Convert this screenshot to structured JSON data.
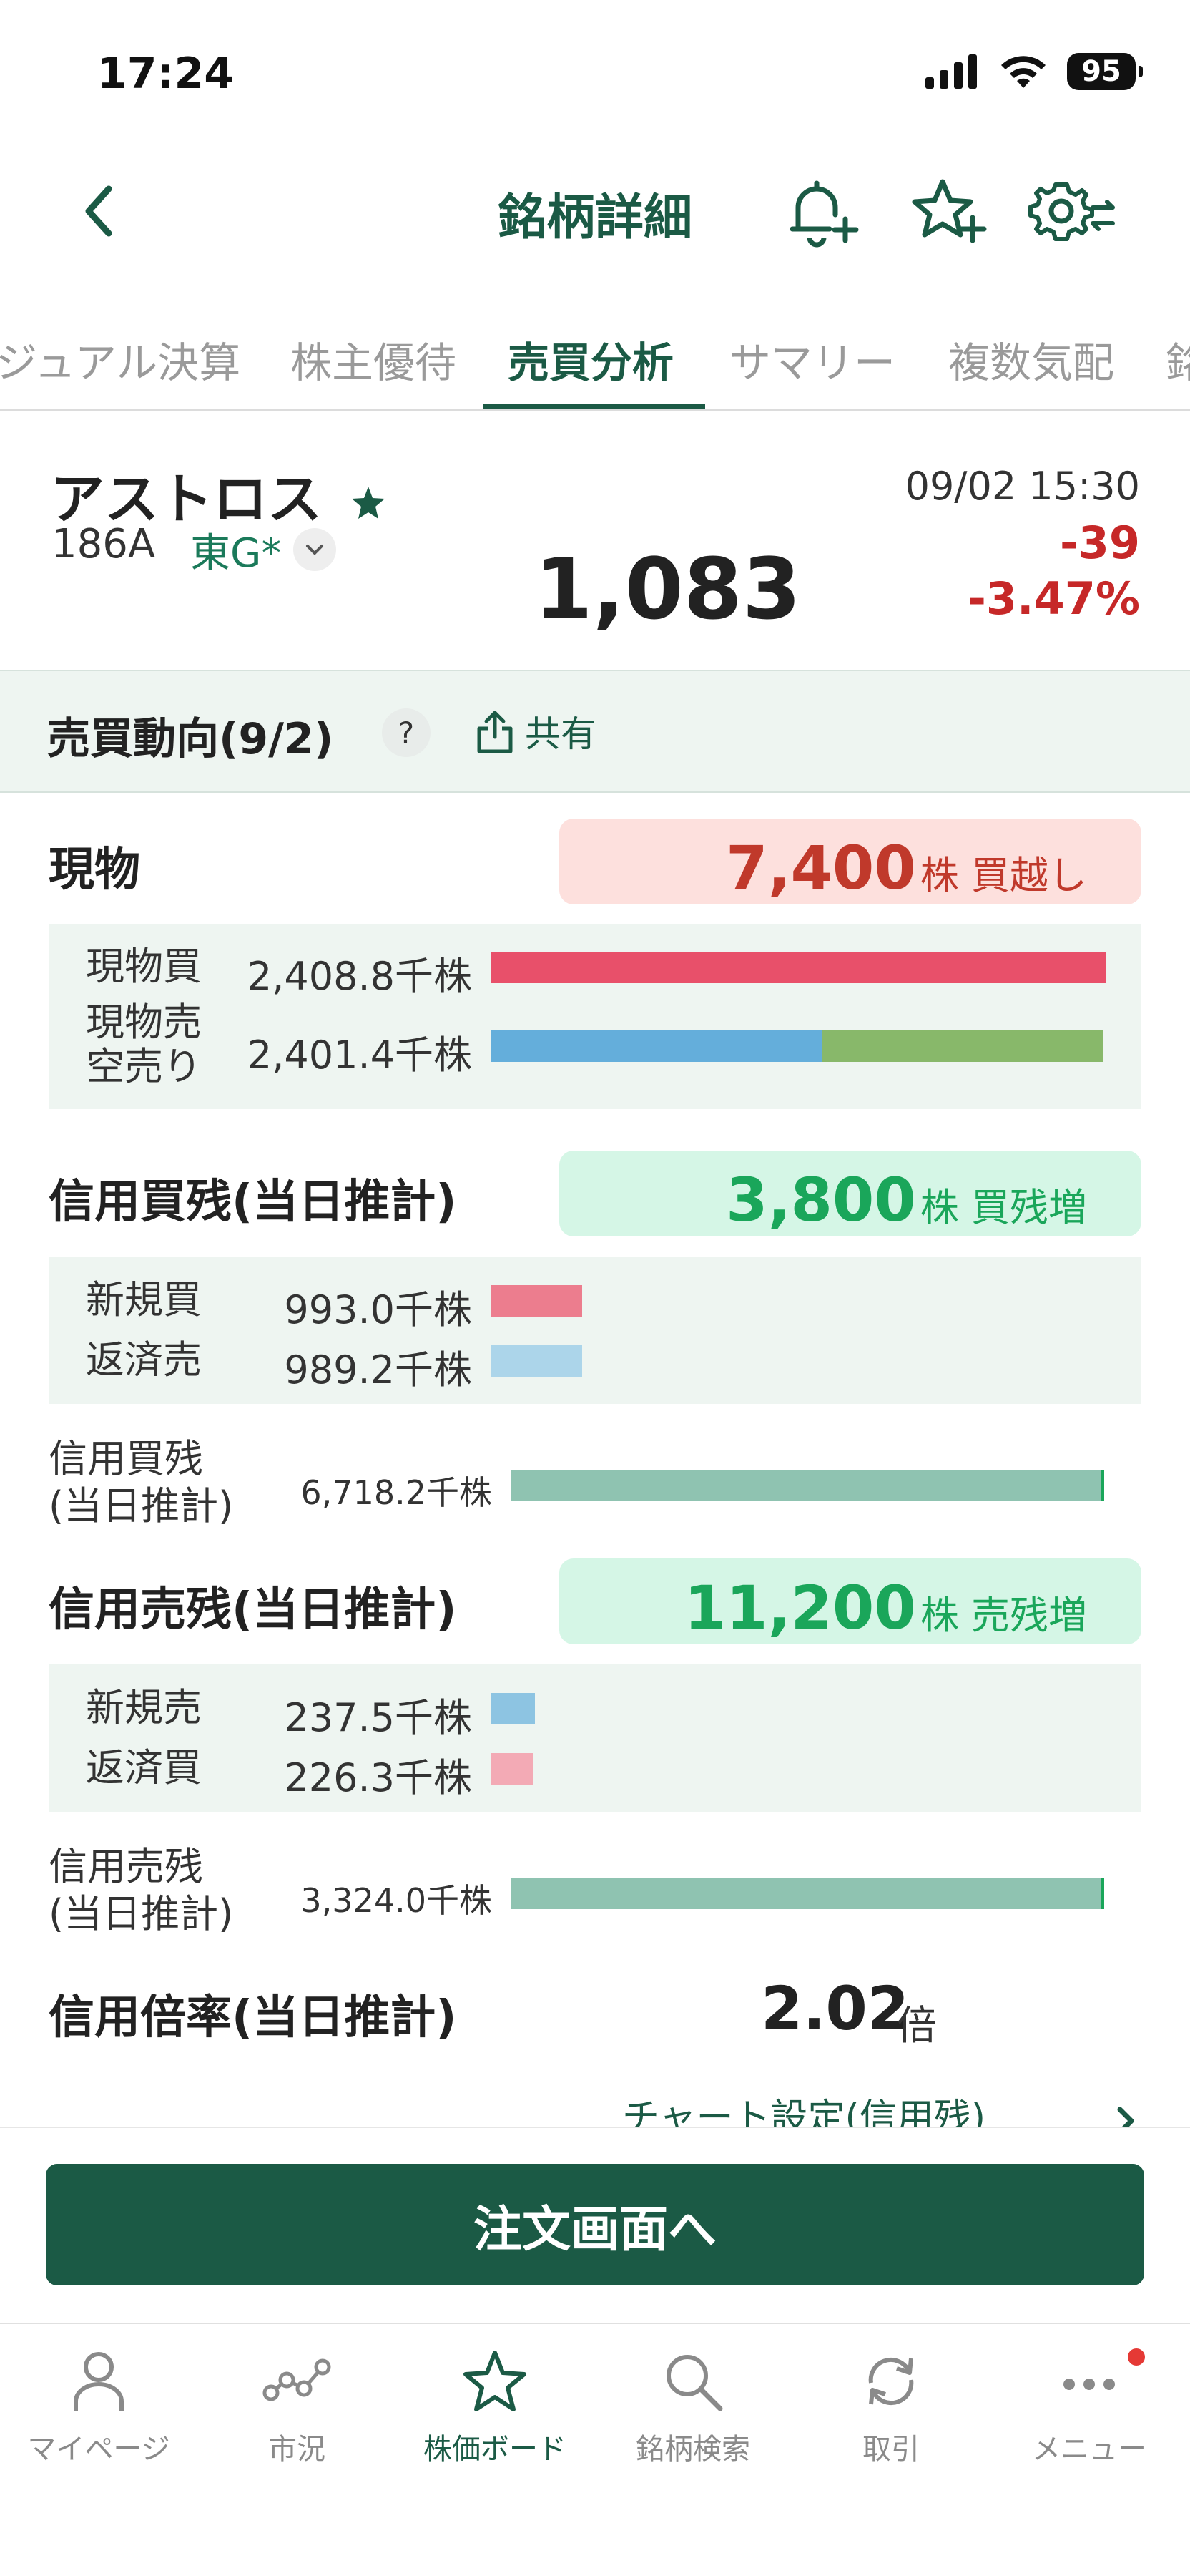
{
  "status_bar": {
    "time": "17:24",
    "battery": "95"
  },
  "header": {
    "title": "銘柄詳細"
  },
  "tabs": [
    {
      "label": "ジュアル決算"
    },
    {
      "label": "株主優待"
    },
    {
      "label": "売買分析",
      "active": true
    },
    {
      "label": "サマリー"
    },
    {
      "label": "複数気配"
    },
    {
      "label": "銘"
    }
  ],
  "stock": {
    "name": "アストロス",
    "code": "186A",
    "market": "東G*",
    "price": "1,083",
    "datetime": "09/02 15:30",
    "change": "-39",
    "change_pct": "-3.47%"
  },
  "section": {
    "title": "売買動向(9/2)",
    "help": "?",
    "share": "共有"
  },
  "genbutsu": {
    "title": "現物",
    "summary_num": "7,400",
    "summary_unit": "株 買越し",
    "rows": [
      {
        "label": "現物買",
        "value": "2,408.8千株"
      },
      {
        "label_line1": "現物売",
        "label_line2": "空売り",
        "value": "2,401.4千株"
      }
    ],
    "buy_bar_fraction": 1.0,
    "sell_bar_fraction": 0.997,
    "short_share_of_sell": 0.46
  },
  "margin_buy": {
    "title": "信用買残(当日推計)",
    "summary_num": "3,800",
    "summary_unit": "株 買残増",
    "rows": [
      {
        "label": "新規買",
        "value": "993.0千株"
      },
      {
        "label": "返済売",
        "value": "989.2千株"
      }
    ],
    "balance_label_line1": "信用買残",
    "balance_label_line2": "(当日推計)",
    "balance_value": "6,718.2千株"
  },
  "margin_sell": {
    "title": "信用売残(当日推計)",
    "summary_num": "11,200",
    "summary_unit": "株 売残増",
    "rows": [
      {
        "label": "新規売",
        "value": "237.5千株"
      },
      {
        "label": "返済買",
        "value": "226.3千株"
      }
    ],
    "balance_label_line1": "信用売残",
    "balance_label_line2": "(当日推計)",
    "balance_value": "3,324.0千株"
  },
  "ratio": {
    "title": "信用倍率(当日推計)",
    "value": "2.02",
    "unit": "倍"
  },
  "chart_link": "チャート設定(信用残)",
  "order_button": "注文画面へ",
  "bottom_nav": [
    {
      "label": "マイページ",
      "icon": "person-icon"
    },
    {
      "label": "市況",
      "icon": "market-icon"
    },
    {
      "label": "株価ボード",
      "icon": "star-icon",
      "active": true
    },
    {
      "label": "銘柄検索",
      "icon": "search-icon"
    },
    {
      "label": "取引",
      "icon": "trade-icon"
    },
    {
      "label": "メニュー",
      "icon": "menu-dots-icon"
    }
  ],
  "colors": {
    "brand": "#1b5a45",
    "down": "#c62828",
    "buy_bar": "#e8506a",
    "sell_bar": "#64aedb",
    "short_bar": "#88b86a",
    "balance_bar": "#8fc3b1"
  }
}
